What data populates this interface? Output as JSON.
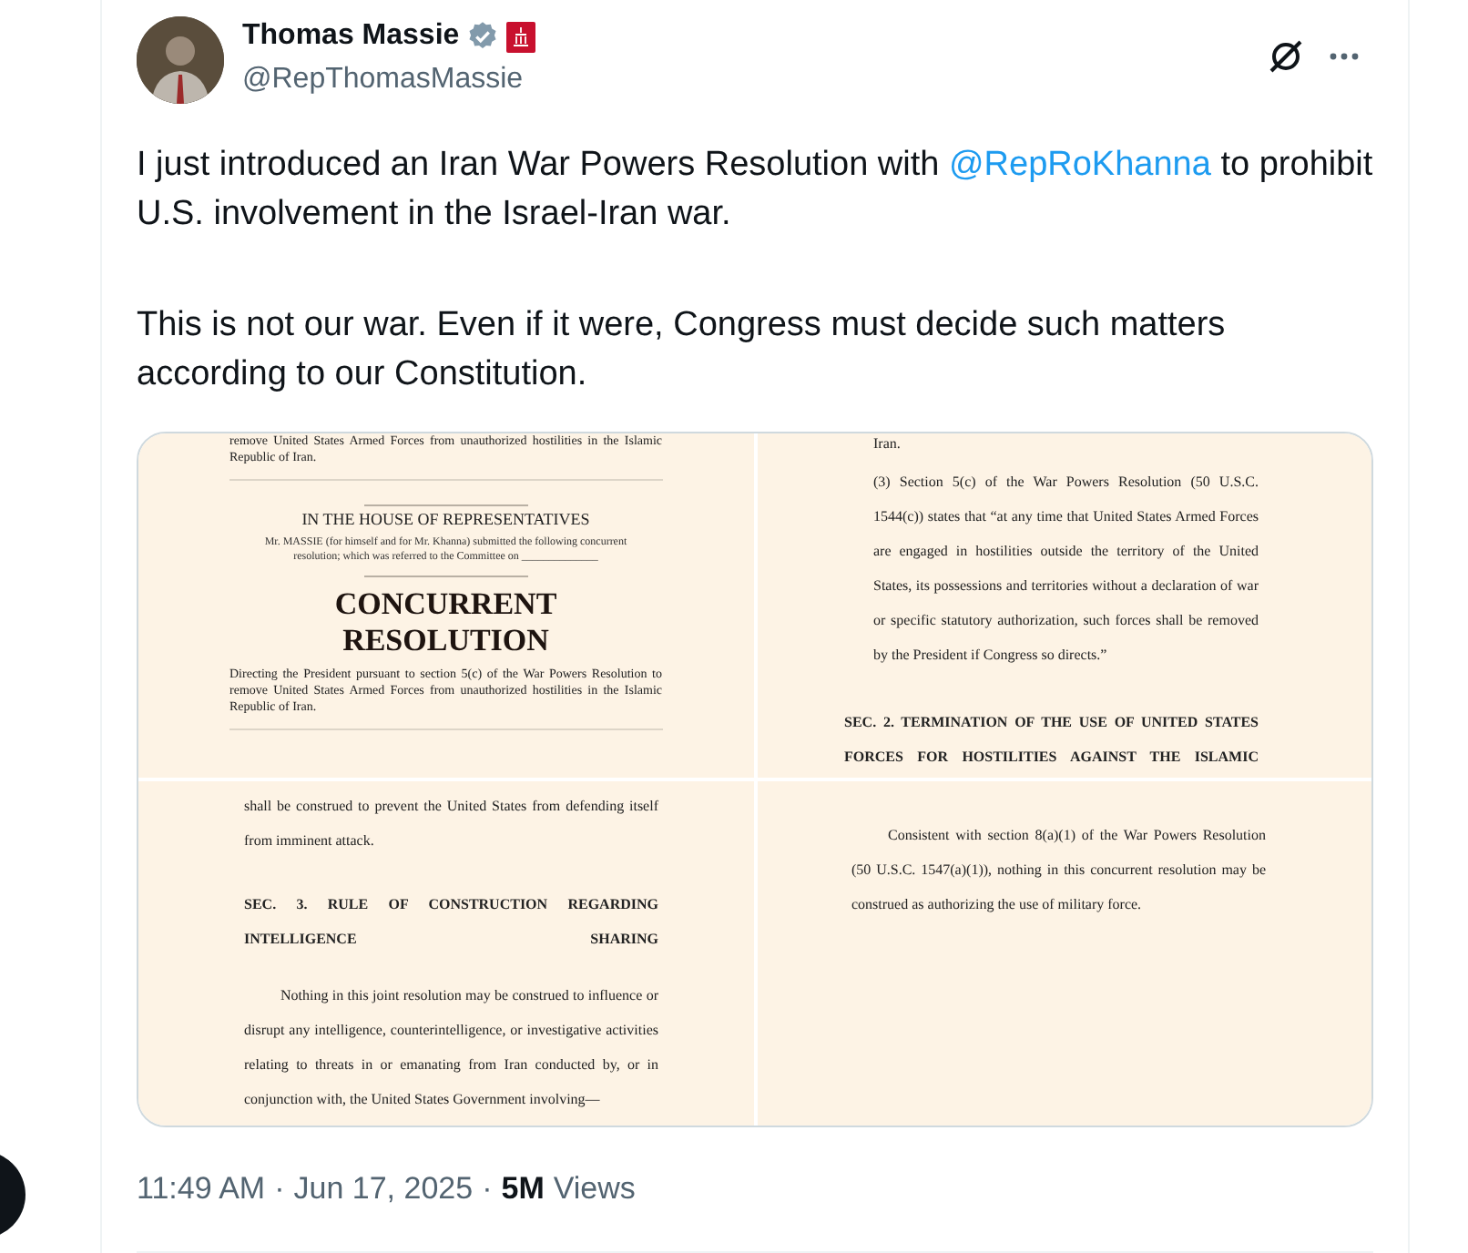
{
  "author": {
    "name": "Thomas Massie",
    "handle": "@RepThomasMassie",
    "verified": true
  },
  "tweet": {
    "paragraphs": [
      [
        {
          "kind": "text",
          "text": "I just introduced an Iran War Powers Resolution with "
        },
        {
          "kind": "mention",
          "text": "@RepRoKhanna"
        },
        {
          "kind": "text",
          "text": " to prohibit U.S. involvement in the Israel-Iran war."
        }
      ],
      [
        {
          "kind": "text",
          "text": "This is not our war.  Even if it were, Congress must decide such matters according to our Constitution."
        }
      ]
    ]
  },
  "media": [
    {
      "blocks": [
        {
          "kind": "para",
          "text": "remove United States Armed Forces from unauthorized hostilities in the Islamic Republic of Iran."
        },
        {
          "kind": "rule"
        },
        {
          "kind": "short-rule"
        },
        {
          "kind": "center",
          "text": "IN THE HOUSE OF REPRESENTATIVES"
        },
        {
          "kind": "small-center",
          "text": "Mr. MASSIE (for himself and for Mr. Khanna) submitted the following concurrent resolution; which was referred to the Committee on ______________"
        },
        {
          "kind": "short-rule"
        },
        {
          "kind": "title",
          "text": "CONCURRENT RESOLUTION"
        },
        {
          "kind": "para",
          "text": "Directing the President pursuant to section 5(c) of the War Powers Resolution to remove United States Armed Forces from unauthorized hostilities in the Islamic Republic of Iran."
        },
        {
          "kind": "rule"
        }
      ]
    },
    {
      "blocks": [
        {
          "kind": "item",
          "text": "Iran."
        },
        {
          "kind": "item",
          "text": "(3) Section 5(c) of the War Powers Resolution (50 U.S.C. 1544(c)) states that “at any time that United States Armed Forces are engaged in hostilities outside the territory of the United States, its possessions and territories without a declaration of war or specific statutory authorization, such forces shall be removed by the President if Congress so directs.”"
        },
        {
          "kind": "heading",
          "text": "SEC. 2. TERMINATION OF THE USE OF UNITED STATES FORCES FOR HOSTILITIES AGAINST THE ISLAMIC"
        }
      ]
    },
    {
      "blocks": [
        {
          "kind": "body",
          "text": "shall be construed to prevent the United States from defending itself from imminent attack."
        },
        {
          "kind": "heading",
          "text": "SEC. 3. RULE OF CONSTRUCTION REGARDING INTELLIGENCE SHARING"
        },
        {
          "kind": "indent",
          "text": "Nothing in this joint resolution may be construed to influence or disrupt any intelligence, counterintelligence, or investigative activities relating to threats in or emanating from Iran conducted by, or in conjunction with, the United States Government involving—"
        }
      ]
    },
    {
      "blocks": [
        {
          "kind": "indent",
          "text": "Consistent with section 8(a)(1) of the War Powers Resolution (50 U.S.C. 1547(a)(1)), nothing in this concurrent resolution may be construed as authorizing the use of military force."
        }
      ]
    }
  ],
  "meta": {
    "time": "11:49 AM",
    "separator": "·",
    "date": "Jun 17, 2025",
    "separator_2": "·",
    "views_count": "5M",
    "views_label": "Views"
  }
}
